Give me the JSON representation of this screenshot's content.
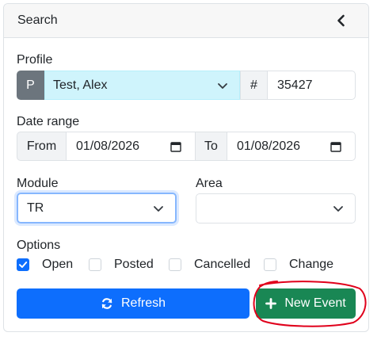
{
  "header": {
    "title": "Search"
  },
  "profile": {
    "label": "Profile",
    "badge": "P",
    "selected": "Test, Alex",
    "hash_label": "#",
    "number": "35427"
  },
  "date_range": {
    "label": "Date range",
    "from_label": "From",
    "from_value": "01/08/2026",
    "to_label": "To",
    "to_value": "01/08/2026"
  },
  "module": {
    "label": "Module",
    "selected": "TR"
  },
  "area": {
    "label": "Area",
    "selected": ""
  },
  "options": {
    "label": "Options",
    "items": [
      {
        "label": "Open",
        "checked": true
      },
      {
        "label": "Posted",
        "checked": false
      },
      {
        "label": "Cancelled",
        "checked": false
      },
      {
        "label": "Change",
        "checked": false
      }
    ]
  },
  "actions": {
    "refresh_label": "Refresh",
    "new_event_label": "New Event"
  },
  "colors": {
    "primary": "#0d6efd",
    "success": "#198754",
    "secondary": "#6c757d",
    "info_light": "#cff4fc",
    "annotation": "#e0001b"
  }
}
